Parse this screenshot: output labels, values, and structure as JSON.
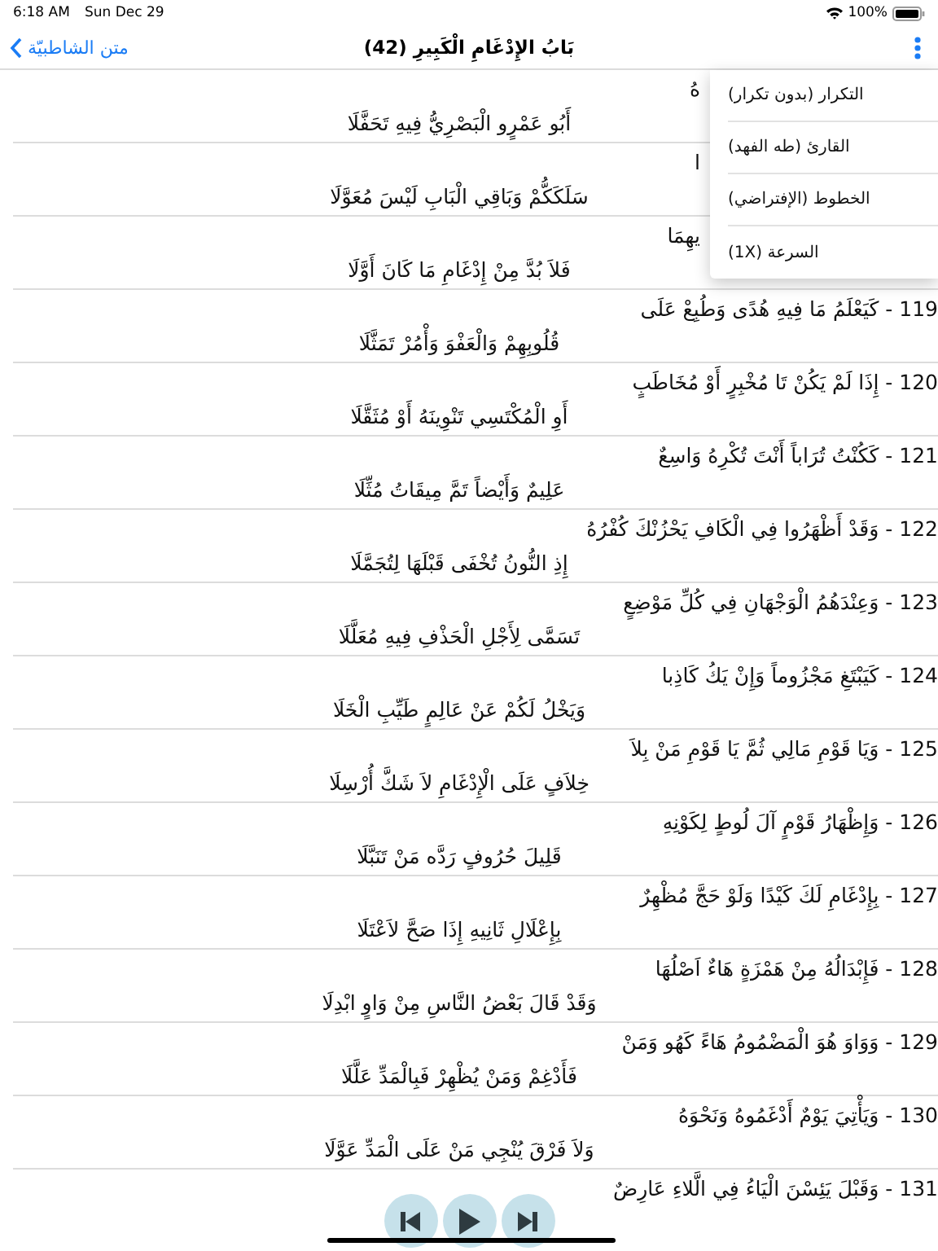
{
  "status_bar": {
    "time": "6:18 AM",
    "date": "Sun Dec 29",
    "battery": "100%"
  },
  "nav_bar": {
    "back_label": "متن الشاطبيّة",
    "title": "بَابُ الإِدْغَامِ الْكَبِيرِ (42)"
  },
  "verses": [
    {
      "line1": "هُ",
      "line2": "أَبُو عَمْرٍو الْبَصْرِيُّ فِيهِ تَحَفَّلَا",
      "covered": true
    },
    {
      "line1": "ا",
      "line2": "سَلَكَكُّمْ وَبَاقِي الْبَابِ لَيْسَ مُعَوَّلَا",
      "covered": true
    },
    {
      "line1": "يهِمَا",
      "line2": "فَلاَ بُدَّ مِنْ إِدْغَامِ مَا كَانَ أَوَّلَا",
      "covered": true
    },
    {
      "line1": "119 - كَيَعْلَمُ مَا فِيهِ هُدًى وَطُبِعْ عَلَى",
      "line2": "قُلُوبِهِمْ وَالْعَفْوَ وَأْمُرْ تَمَثَّلَا",
      "covered": false
    },
    {
      "line1": "120 - إِذَا لَمْ يَكُنْ تَا مُخْبِرٍ أَوْ مُخَاطَبٍ",
      "line2": "أَوِ الْمُكْتَسِي تَنْوِينَهُ أَوْ مُثَقَّلَا",
      "covered": false
    },
    {
      "line1": "121 - كَكُنْتُ تُرَاباً أَنْتَ تُكْرِهُ وَاسِعٌ",
      "line2": "عَلِيمٌ وَأَيْضاً تَمَّ مِيقَاتُ مُثِّلَا",
      "covered": false
    },
    {
      "line1": "122 - وَقَدْ أَظْهَرُوا فِي الْكَافِ يَحْزُنْكَ كُفْرُهُ",
      "line2": "إِذِ النُّونُ تُخْفَى قَبْلَهَا لِتُجَمَّلَا",
      "covered": false
    },
    {
      "line1": "123 - وَعِنْدَهُمُ الْوَجْهَانِ فِي كُلِّ مَوْضِعٍ",
      "line2": "تَسَمَّى لِأَجْلِ الْحَذْفِ فِيهِ مُعَلَّلَا",
      "covered": false
    },
    {
      "line1": "124 - كَيَبْتَغِ مَجْزُوماً وَإِنْ يَكُ كَاذِبا",
      "line2": "وَيَخْلُ لَكُمْ عَنْ عَالِمٍ طَيِّبِ الْخَلَا",
      "covered": false
    },
    {
      "line1": "125 - وَيَا قَوْمِ مَالِي ثُمَّ يَا قَوْمِ مَنْ بِلاَ",
      "line2": "خِلاَفٍ عَلَى الْإِدْغَامِ لاَ شَكَّ أُرْسِلَا",
      "covered": false
    },
    {
      "line1": "126 - وَإِظْهَارُ قَوْمٍ آلَ لُوطٍ لِكَوْنِهِ",
      "line2": "قَلِيلَ حُرُوفٍ رَدَّه مَنْ تَنَبَّلَا",
      "covered": false
    },
    {
      "line1": "127 - بِإِدْغَامِ لَكَ كَيْدًا وَلَوْ حَجَّ مُظْهِرٌ",
      "line2": "بِإِعْلَالِ ثَانِيهِ إِذَا صَحَّ لاَعْتَلَا",
      "covered": false
    },
    {
      "line1": "128 - فَإِبْدَالُهُ مِنْ هَمْزَةٍ هَاءٌ اَصْلُهَا",
      "line2": "وَقَدْ قَالَ بَعْضُ النَّاسِ مِنْ وَاوٍ ابْدِلَا",
      "covered": false
    },
    {
      "line1": "129 - وَوَاوَ هُوَ الْمَضْمُومُ هَاءً كَهُو وَمَنْ",
      "line2": "فَأَدْغِمْ وَمَنْ يُظْهِرْ فَبِالْمَدِّ عَلَّلَا",
      "covered": false
    },
    {
      "line1": "130 - وَيَأْتِيَ يَوْمٌ أَدْغَمُوهُ وَنَحْوَهُ",
      "line2": "وَلاَ فَرْقَ يُنْجِي مَنْ عَلَى الْمَدِّ عَوَّلَا",
      "covered": false
    },
    {
      "line1": "131 - وَقَبْلَ يَئِسْنَ الْيَاءُ فِي الَّلاءِ عَارِضٌ",
      "covered": false
    }
  ],
  "menu": {
    "items": [
      "التكرار (بدون تكرار)",
      "القارئ (طه الفهد)",
      "الخطوط (الإفتراضي)",
      "السرعة (1X)"
    ]
  },
  "player": {
    "buttons": [
      {
        "kind": "previous"
      },
      {
        "kind": "play"
      },
      {
        "kind": "next"
      }
    ]
  }
}
